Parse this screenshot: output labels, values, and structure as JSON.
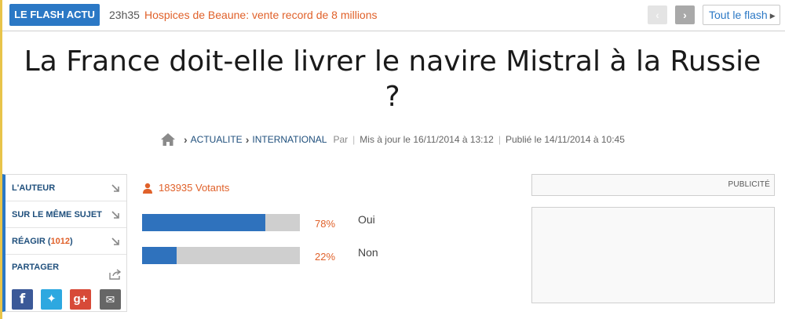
{
  "flash": {
    "badge": "LE FLASH ACTU",
    "time": "23h35",
    "headline": "Hospices de Beaune: vente record de 8 millions",
    "prev_icon": "chevron-left-icon",
    "next_icon": "chevron-right-icon",
    "all_label": "Tout le flash"
  },
  "article": {
    "title": "La France doit-elle livrer le navire Mistral à la Russie ?"
  },
  "breadcrumb": {
    "items": [
      "ACTUALITE",
      "INTERNATIONAL"
    ],
    "author_prefix": "Par",
    "updated": "Mis à jour le 16/11/2014 à 13:12",
    "published": "Publié le 14/11/2014 à 10:45"
  },
  "sidebar": {
    "items": [
      {
        "label": "L'AUTEUR"
      },
      {
        "label": "SUR LE MÊME SUJET"
      },
      {
        "label": "RÉAGIR",
        "count": "1012"
      }
    ],
    "share_label": "PARTAGER",
    "socials": [
      "facebook-icon",
      "twitter-icon",
      "google-plus-icon",
      "email-icon"
    ]
  },
  "poll": {
    "votants": "183935 Votants",
    "options": [
      {
        "label": "Oui",
        "pct_text": "78%",
        "percent": 78
      },
      {
        "label": "Non",
        "pct_text": "22%",
        "percent": 22
      }
    ]
  },
  "ad": {
    "label": "PUBLICITÉ"
  },
  "colors": {
    "accent_blue": "#2b78c5",
    "accent_orange": "#e0612a",
    "bar_fill": "#2f72bd",
    "bar_track": "#cfcfcf"
  }
}
